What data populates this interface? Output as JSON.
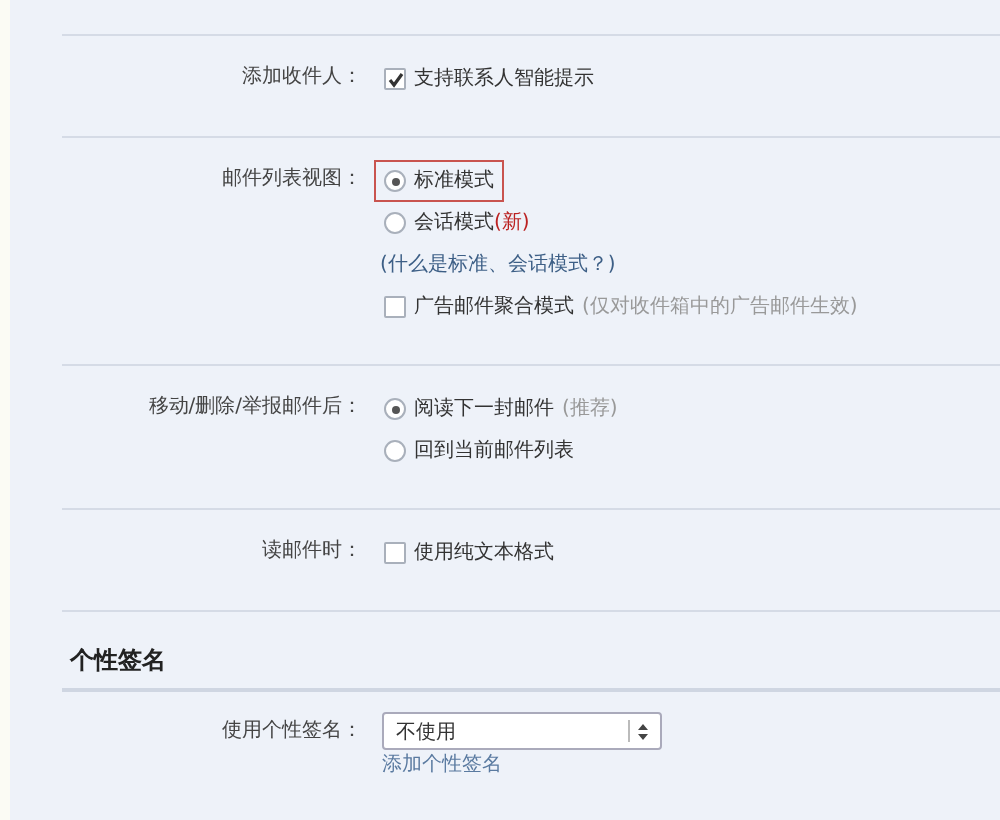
{
  "settings": [
    {
      "label": "添加收件人：",
      "options": [
        {
          "kind": "checkbox",
          "text": "支持联系人智能提示",
          "checked": true
        }
      ]
    },
    {
      "label": "邮件列表视图：",
      "options": [
        {
          "kind": "radio",
          "text": "标准模式",
          "selected": true,
          "highlighted": true
        },
        {
          "kind": "radio",
          "text": "会话模式",
          "tag": "(新)",
          "selected": false,
          "highlighted": false
        },
        {
          "kind": "link",
          "text": "(什么是标准、会话模式？)"
        },
        {
          "kind": "checkbox",
          "text": "广告邮件聚合模式",
          "note": "(仅对收件箱中的广告邮件生效)",
          "checked": false
        }
      ]
    },
    {
      "label": "移动/删除/举报邮件后：",
      "options": [
        {
          "kind": "radio",
          "text": "阅读下一封邮件",
          "note": "(推荐)",
          "selected": true,
          "highlighted": false
        },
        {
          "kind": "radio",
          "text": "回到当前邮件列表",
          "selected": false,
          "highlighted": false
        }
      ]
    },
    {
      "label": "读邮件时：",
      "options": [
        {
          "kind": "checkbox",
          "text": "使用纯文本格式",
          "checked": false
        }
      ]
    }
  ],
  "signature": {
    "heading": "个性签名",
    "label": "使用个性签名：",
    "select": {
      "value": "不使用"
    },
    "link": "添加个性签名"
  }
}
